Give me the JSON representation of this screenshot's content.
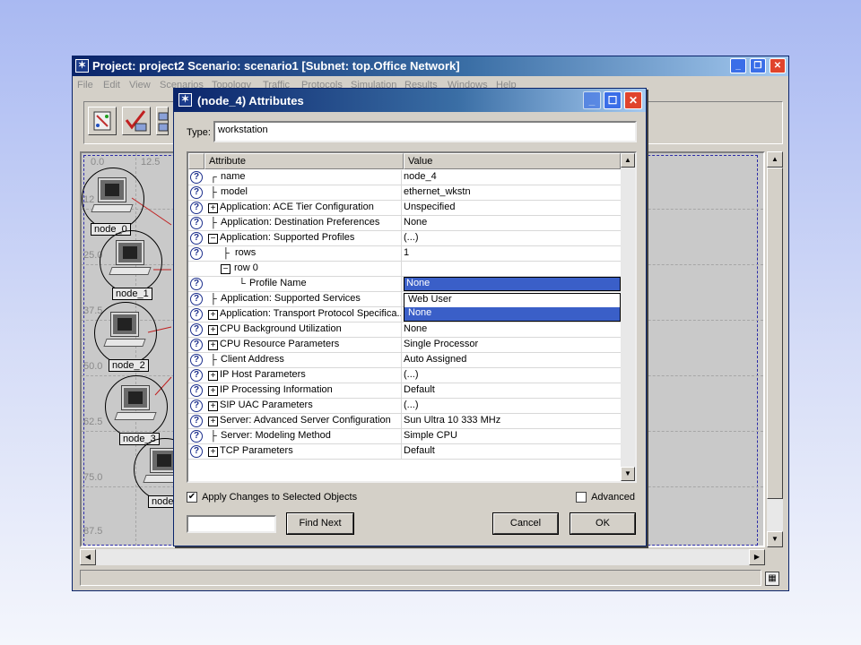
{
  "main_window": {
    "title": "Project: project2 Scenario: scenario1  [Subnet: top.Office Network]",
    "menus": [
      "File",
      "Edit",
      "View",
      "Scenarios",
      "Topology",
      "Traffic",
      "Protocols",
      "Simulation",
      "Results",
      "Windows",
      "Help"
    ],
    "ruler_top": [
      "0.0",
      "12.5"
    ],
    "ruler_left": [
      "12",
      "25.0",
      "37.5",
      "50.0",
      "62.5",
      "75.0",
      "87.5"
    ],
    "nodes": [
      "node_0",
      "node_1",
      "node_2",
      "node_3",
      "node_"
    ]
  },
  "dialog": {
    "title": "(node_4) Attributes",
    "type_label": "Type:",
    "type_value": "workstation",
    "columns": {
      "attribute": "Attribute",
      "value": "Value"
    },
    "rows": [
      {
        "attr": "name",
        "value": "node_4"
      },
      {
        "attr": "model",
        "value": "ethernet_wkstn"
      },
      {
        "attr": "Application: ACE Tier Configuration",
        "value": "Unspecified"
      },
      {
        "attr": "Application: Destination Preferences",
        "value": "None"
      },
      {
        "attr": "Application: Supported Profiles",
        "value": "(...)"
      },
      {
        "attr": "rows",
        "value": "1"
      },
      {
        "attr": "row 0",
        "value": ""
      },
      {
        "attr": "Profile Name",
        "value": "None"
      },
      {
        "attr": "Application: Supported Services",
        "value": ""
      },
      {
        "attr": "Application: Transport Protocol Specifica...",
        "value": ""
      },
      {
        "attr": "CPU Background Utilization",
        "value": "None"
      },
      {
        "attr": "CPU Resource Parameters",
        "value": "Single Processor"
      },
      {
        "attr": "Client Address",
        "value": "Auto Assigned"
      },
      {
        "attr": "IP Host Parameters",
        "value": "(...)"
      },
      {
        "attr": "IP Processing Information",
        "value": "Default"
      },
      {
        "attr": "SIP UAC Parameters",
        "value": "(...)"
      },
      {
        "attr": "Server: Advanced Server Configuration",
        "value": "Sun Ultra 10 333 MHz"
      },
      {
        "attr": "Server: Modeling Method",
        "value": "Simple CPU"
      },
      {
        "attr": "TCP Parameters",
        "value": "Default"
      }
    ],
    "dropdown_options": [
      "Web User",
      "None"
    ],
    "dropdown_selected": "None",
    "apply_changes_label": "Apply Changes to Selected Objects",
    "apply_changes_checked": true,
    "advanced_label": "Advanced",
    "advanced_checked": false,
    "find_next_label": "Find Next",
    "cancel_label": "Cancel",
    "ok_label": "OK"
  }
}
